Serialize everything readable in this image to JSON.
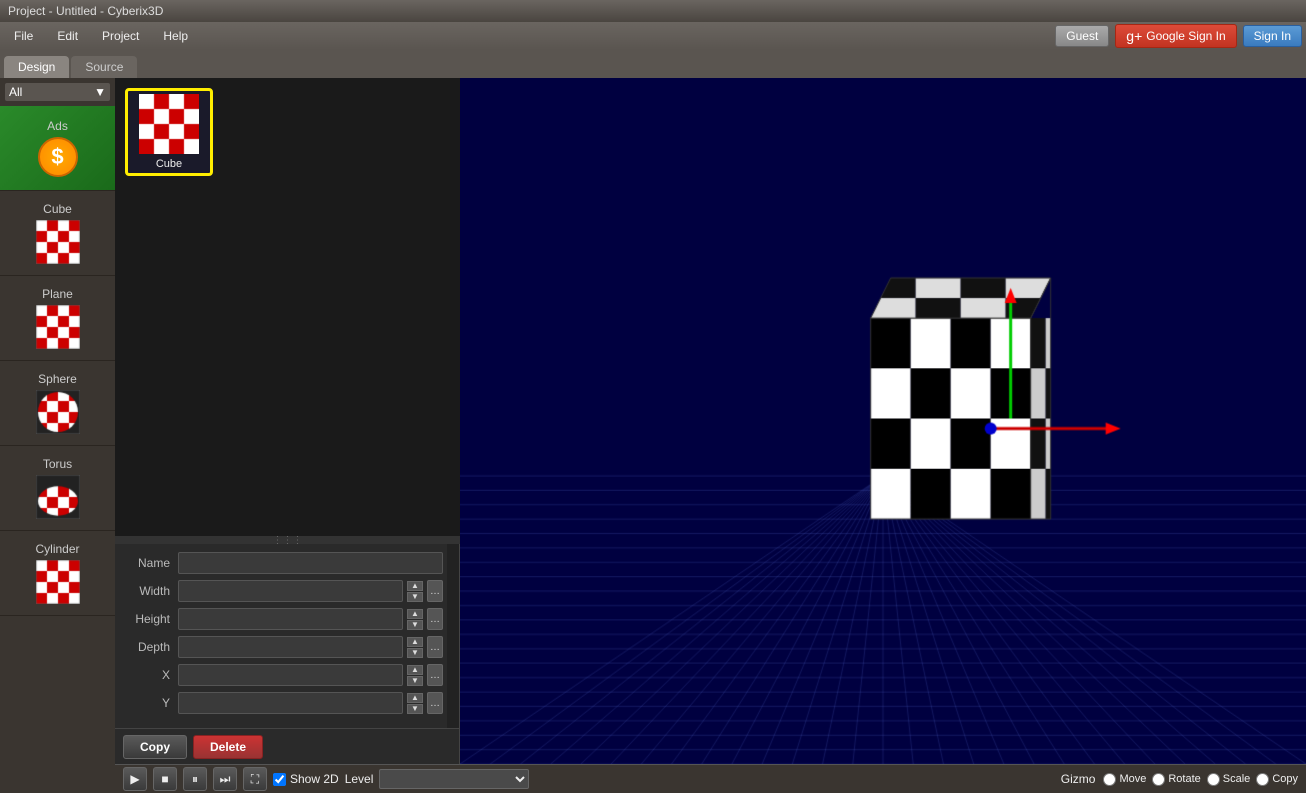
{
  "titleBar": {
    "text": "Project - Untitled - Cyberix3D"
  },
  "menuBar": {
    "items": [
      "File",
      "Edit",
      "Project",
      "Help"
    ]
  },
  "auth": {
    "guestLabel": "Guest",
    "googleSignInLabel": "Google Sign In",
    "signInLabel": "Sign In"
  },
  "tabs": [
    {
      "id": "design",
      "label": "Design",
      "active": true
    },
    {
      "id": "source",
      "label": "Source",
      "active": false
    }
  ],
  "sidebar": {
    "categoryLabel": "All",
    "items": [
      {
        "id": "ads",
        "label": "Ads",
        "type": "ads"
      },
      {
        "id": "cube",
        "label": "Cube",
        "type": "checker"
      },
      {
        "id": "plane",
        "label": "Plane",
        "type": "checker"
      },
      {
        "id": "sphere",
        "label": "Sphere",
        "type": "checker-sphere"
      },
      {
        "id": "torus",
        "label": "Torus",
        "type": "checker-torus"
      },
      {
        "id": "cylinder",
        "label": "Cylinder",
        "type": "checker"
      }
    ]
  },
  "objectPanel": {
    "items": [
      {
        "id": "cube-selected",
        "label": "Cube",
        "selected": true
      }
    ]
  },
  "properties": {
    "fields": [
      {
        "id": "name",
        "label": "Name",
        "value": "",
        "hasSpinner": false,
        "hasDots": false
      },
      {
        "id": "width",
        "label": "Width",
        "value": "",
        "hasSpinner": true,
        "hasDots": true
      },
      {
        "id": "height",
        "label": "Height",
        "value": "",
        "hasSpinner": true,
        "hasDots": true
      },
      {
        "id": "depth",
        "label": "Depth",
        "value": "",
        "hasSpinner": true,
        "hasDots": true
      },
      {
        "id": "x",
        "label": "X",
        "value": "",
        "hasSpinner": true,
        "hasDots": true
      },
      {
        "id": "y",
        "label": "Y",
        "value": "",
        "hasSpinner": true,
        "hasDots": true
      }
    ]
  },
  "bottomButtons": {
    "copyLabel": "Copy",
    "deleteLabel": "Delete"
  },
  "viewport": {
    "toolbar": {
      "show2dLabel": "Show 2D",
      "show2dChecked": true,
      "levelLabel": "Level",
      "gizmoLabel": "Gizmo",
      "moveLabel": "Move",
      "rotateLabel": "Rotate",
      "scaleLabel": "Scale",
      "copyLabel": "Copy"
    }
  }
}
